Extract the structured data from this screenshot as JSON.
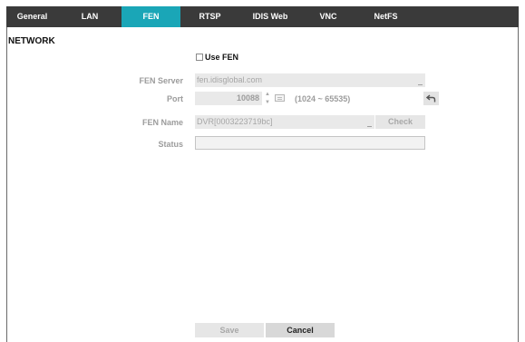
{
  "tabs": [
    {
      "label": "General",
      "active": false
    },
    {
      "label": "LAN",
      "active": false
    },
    {
      "label": "FEN",
      "active": true
    },
    {
      "label": "RTSP",
      "active": false
    },
    {
      "label": "IDIS Web",
      "active": false
    },
    {
      "label": "VNC",
      "active": false
    },
    {
      "label": "NetFS",
      "active": false
    }
  ],
  "section_title": "NETWORK",
  "use_fen": {
    "label": "Use FEN",
    "checked": false
  },
  "fields": {
    "fen_server": {
      "label": "FEN Server",
      "value": "fen.idisglobal.com"
    },
    "port": {
      "label": "Port",
      "value": "10088",
      "range": "(1024 ~ 65535)"
    },
    "fen_name": {
      "label": "FEN Name",
      "value": "DVR[0003223719bc]",
      "check_label": "Check"
    },
    "status": {
      "label": "Status",
      "value": ""
    }
  },
  "buttons": {
    "save": "Save",
    "cancel": "Cancel"
  },
  "colors": {
    "tabbar": "#3a3a3a",
    "active_tab": "#1aa6b7",
    "disabled_text": "#9c9c9c"
  }
}
